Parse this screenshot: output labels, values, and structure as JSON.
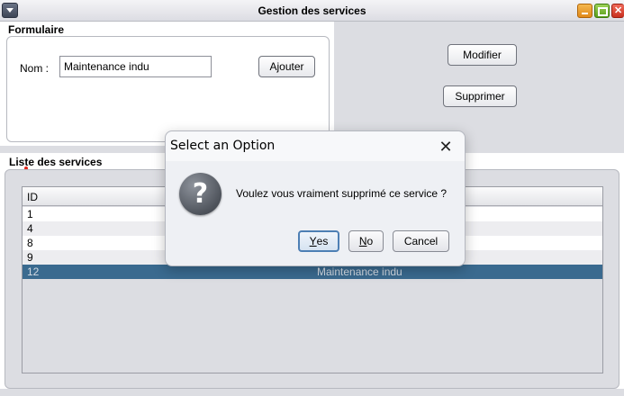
{
  "window": {
    "title": "Gestion des services"
  },
  "form": {
    "section_title": "Formulaire",
    "nom_label": "Nom :",
    "nom_value": "Maintenance indu",
    "add_button": "Ajouter",
    "modify_button": "Modifier",
    "delete_button": "Supprimer"
  },
  "list": {
    "section_title": "Liste des services",
    "columns": [
      "ID",
      ""
    ],
    "rows": [
      {
        "id": "1",
        "nom": ""
      },
      {
        "id": "4",
        "nom": ""
      },
      {
        "id": "8",
        "nom": ""
      },
      {
        "id": "9",
        "nom": ""
      },
      {
        "id": "12",
        "nom": "Maintenance indu",
        "selected": true
      }
    ]
  },
  "dialog": {
    "title": "Select an Option",
    "message": "Voulez vous vraiment supprimé ce service ?",
    "yes_mnemonic": "Y",
    "yes_rest": "es",
    "no_mnemonic": "N",
    "no_rest": "o",
    "cancel": "Cancel",
    "icon": "question-icon",
    "close_icon": "close-icon"
  },
  "colors": {
    "selection": "#3a6a8f",
    "default_button_border": "#4d7fb4"
  }
}
